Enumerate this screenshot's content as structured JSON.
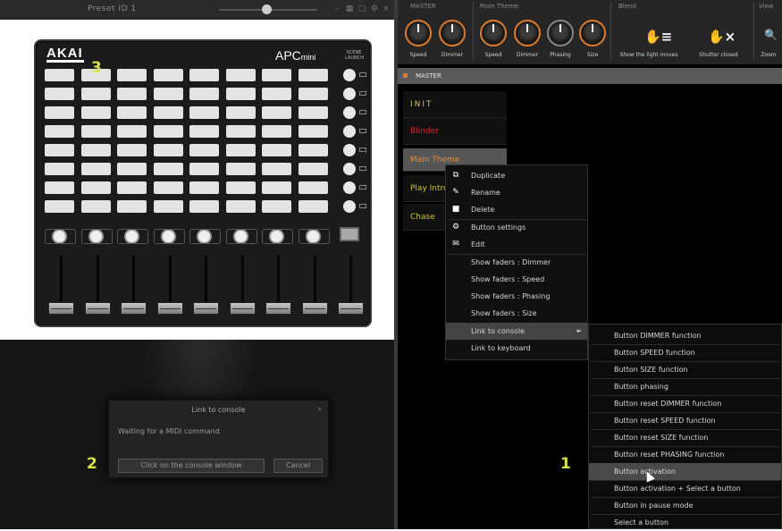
{
  "left_window": {
    "title": "Preset ID 1",
    "device": {
      "brand": "AKAI",
      "model": "APC",
      "model_suffix": "mini",
      "shift_label": "SCENE LAUNCH",
      "pad_rows": 8,
      "pad_cols": 8
    }
  },
  "markers": {
    "one": "1",
    "two": "2",
    "three": "3"
  },
  "dialog": {
    "title": "Link to console",
    "close": "×",
    "message": "Waiting for a MIDI command",
    "primary_button": "Click on the console window",
    "cancel_button": "Cancel"
  },
  "toolbar": {
    "group_labels": [
      "MASTER",
      "Main Theme",
      "Blend",
      "View"
    ],
    "knobs": [
      {
        "label": "Speed",
        "color": "#e07b2a"
      },
      {
        "label": "Dimmer",
        "color": "#e07b2a"
      },
      {
        "label": "Speed",
        "color": "#e07b2a"
      },
      {
        "label": "Dimmer",
        "color": "#e07b2a"
      },
      {
        "label": "Phasing",
        "color": "#888888"
      },
      {
        "label": "Size",
        "color": "#e07b2a"
      }
    ],
    "actions": [
      {
        "icon": "blend-icon",
        "glyph": "✋≡",
        "label": "Show the light moves"
      },
      {
        "icon": "stop-blend-icon",
        "glyph": "✋×",
        "label": "Shutter closed"
      },
      {
        "icon": "zoom-icon",
        "glyph": "🔍",
        "label": "Zoom"
      }
    ]
  },
  "tab": {
    "label": "MASTER"
  },
  "cue_buttons": {
    "init": "INIT",
    "blinder": "Blinder",
    "main_theme": "Main Theme",
    "play": "Play Intro",
    "chase": "Chase"
  },
  "context_menu": {
    "items": [
      {
        "label": "Duplicate",
        "icon": "duplicate-icon",
        "glyph": "⧉"
      },
      {
        "label": "Rename",
        "icon": "rename-icon",
        "glyph": "✎"
      },
      {
        "label": "Delete",
        "icon": "delete-icon",
        "glyph": "■"
      },
      {
        "label": "Button settings",
        "icon": "settings-icon",
        "glyph": "⚙"
      },
      {
        "label": "Edit",
        "icon": "edit-icon",
        "glyph": "✉"
      },
      {
        "label": "Show faders : Dimmer"
      },
      {
        "label": "Show faders : Speed"
      },
      {
        "label": "Show faders : Phasing"
      },
      {
        "label": "Show faders : Size"
      },
      {
        "label": "Link to console",
        "arrow": "►"
      },
      {
        "label": "Link to keyboard"
      }
    ]
  },
  "submenu": {
    "items": [
      "Button DIMMER function",
      "Button SPEED function",
      "Button SIZE function",
      "Button phasing",
      "Button reset DIMMER function",
      "Button reset SPEED function",
      "Button reset SIZE function",
      "Button reset PHASING function",
      "Button activation",
      "Button activation + Select a button",
      "Button in pause mode",
      "Select a button"
    ],
    "highlighted_index": 8
  }
}
